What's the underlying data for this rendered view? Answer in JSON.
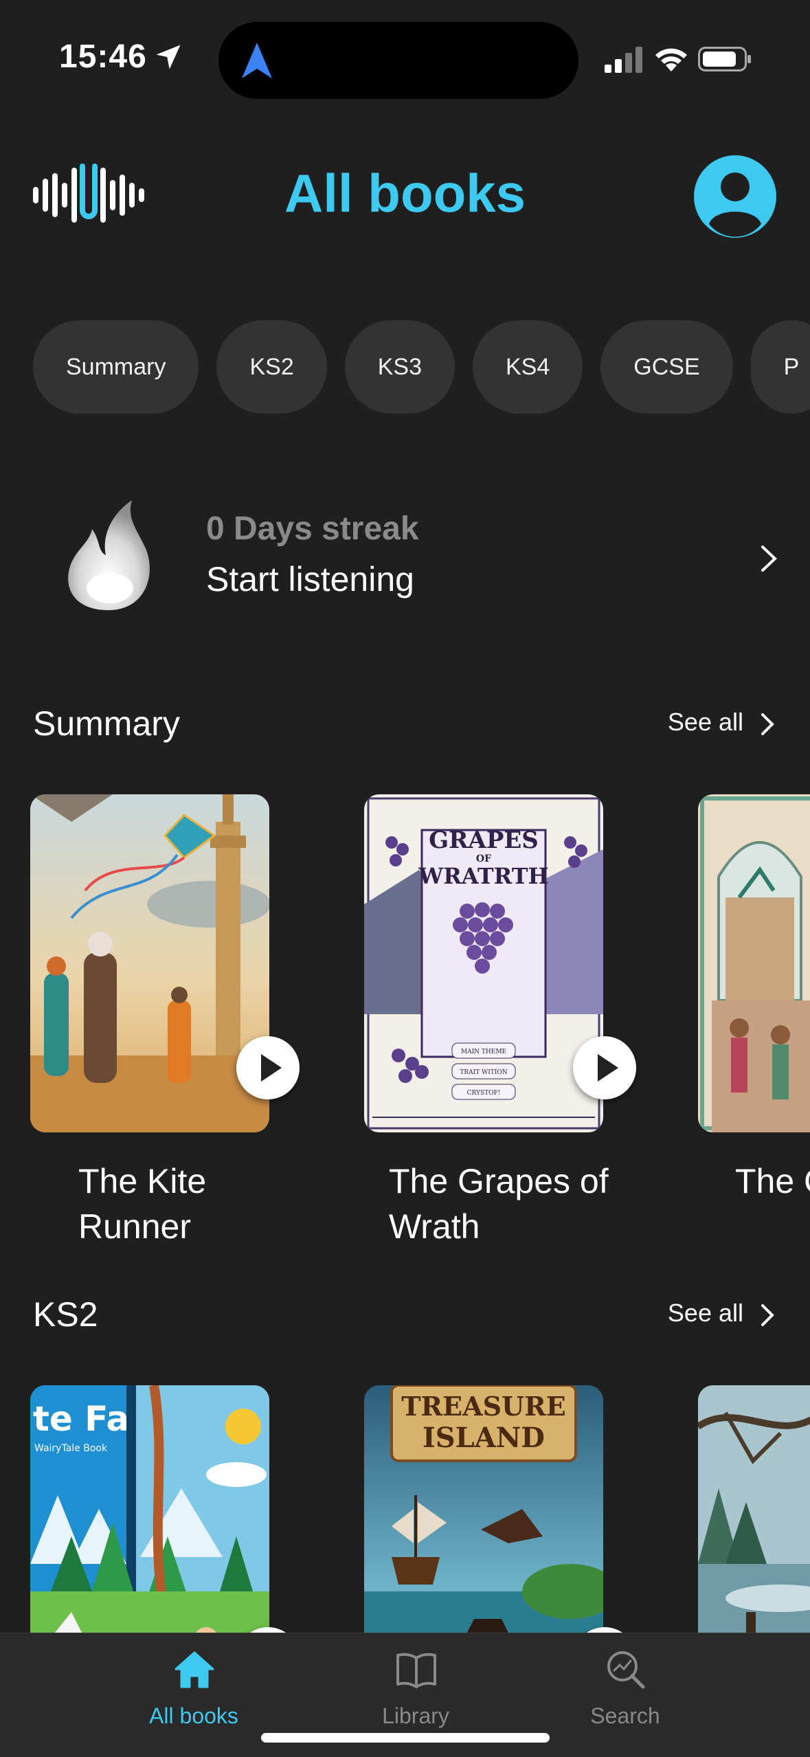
{
  "status_bar": {
    "time": "15:46"
  },
  "header": {
    "title": "All books"
  },
  "chips": [
    "Summary",
    "KS2",
    "KS3",
    "KS4",
    "GCSE",
    "P"
  ],
  "streak": {
    "count_text": "0 Days streak",
    "action_text": "Start listening"
  },
  "sections": [
    {
      "title": "Summary",
      "see_all": "See all",
      "books": [
        {
          "title": "The Kite Runner"
        },
        {
          "title": "The Grapes of Wrath"
        },
        {
          "title": "The C Mena"
        }
      ]
    },
    {
      "title": "KS2",
      "see_all": "See all",
      "books": [
        {
          "title": "White Fang",
          "cover_text": "te Fang",
          "cover_sub": "WairyTale Book"
        },
        {
          "title": "Treasure Island",
          "cover_text_1": "TREASURE",
          "cover_text_2": "ISLAND"
        },
        {
          "title": ""
        }
      ]
    }
  ],
  "covers": {
    "grapes": {
      "line1": "GRAPES",
      "line2": "OF",
      "line3": "WRATRTH",
      "btn1": "MAIN THEME",
      "btn2": "TRAIT WITION",
      "btn3": "CRYSTOF!"
    }
  },
  "tabs": [
    {
      "label": "All books",
      "icon": "home-icon",
      "active": true
    },
    {
      "label": "Library",
      "icon": "book-icon",
      "active": false
    },
    {
      "label": "Search",
      "icon": "search-icon",
      "active": false
    }
  ],
  "colors": {
    "accent": "#3ec9f0",
    "background": "#1f1f1f",
    "chip": "#333333",
    "tabbar": "#2a2a2a"
  }
}
